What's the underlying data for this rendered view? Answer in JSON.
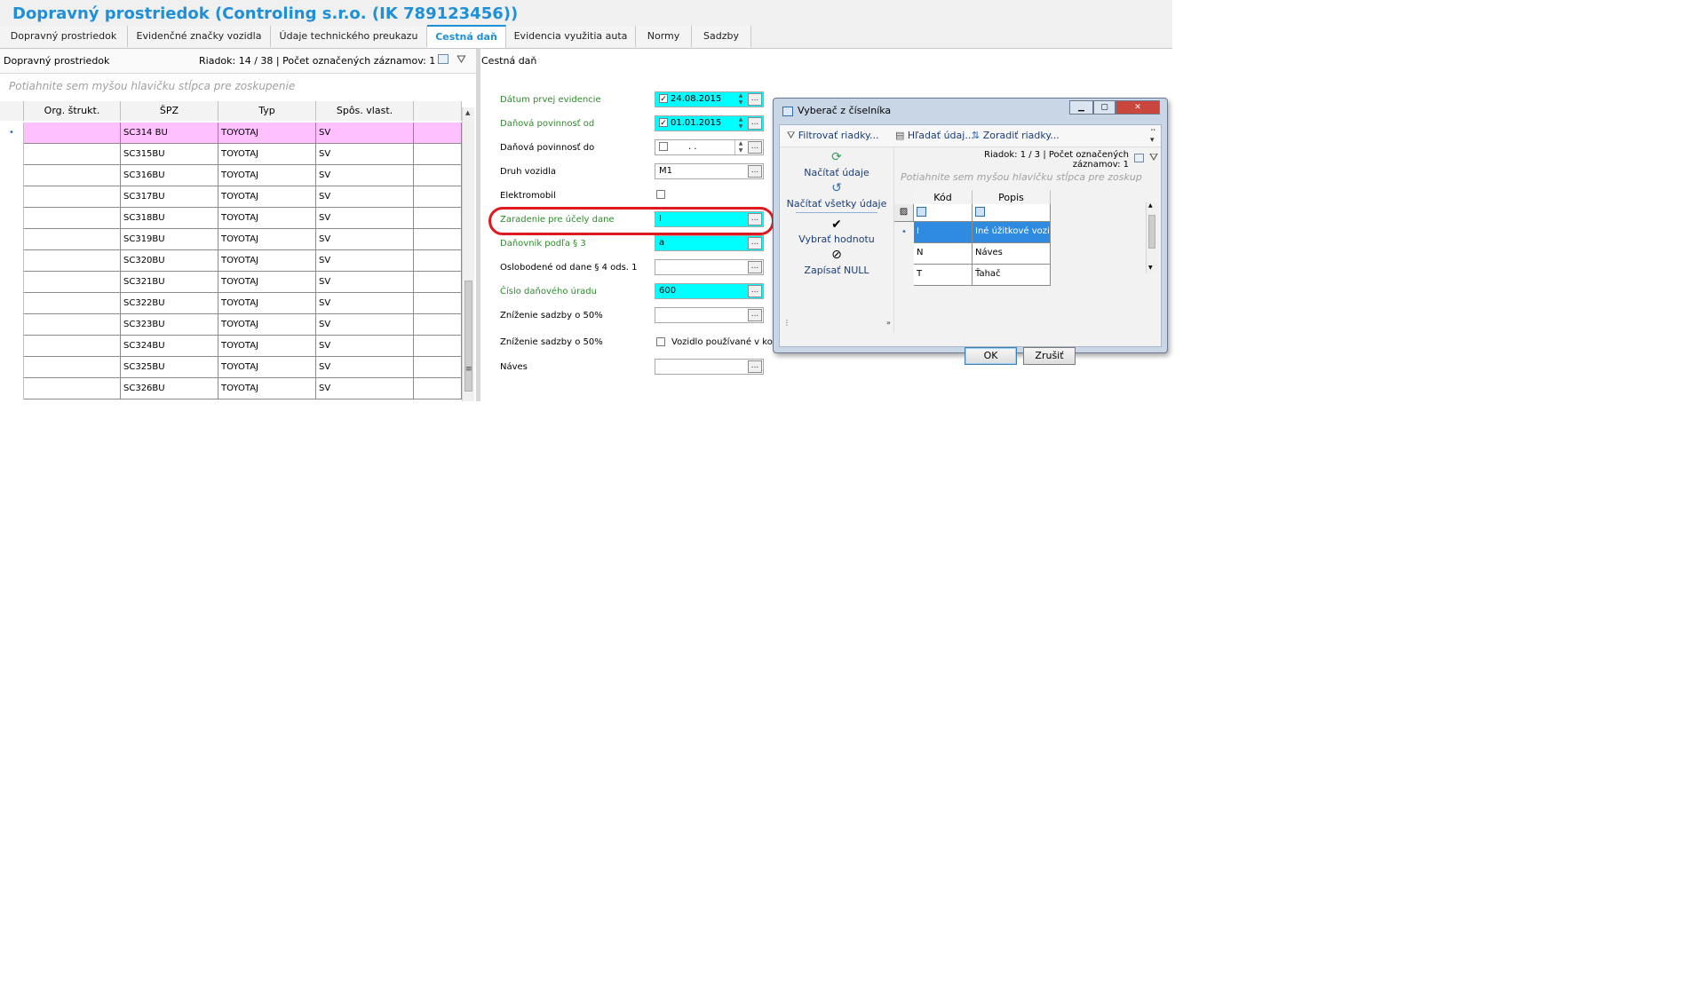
{
  "window": {
    "title": "Dopravný prostriedok (Controling s.r.o. (IK 789123456))"
  },
  "tabs": [
    {
      "label": "Dopravný prostriedok",
      "active": false
    },
    {
      "label": "Evidenčné značky vozidla",
      "active": false
    },
    {
      "label": "Údaje technického preukazu",
      "active": false
    },
    {
      "label": "Cestná daň",
      "active": true
    },
    {
      "label": "Evidencia využitia auta",
      "active": false
    },
    {
      "label": "Normy",
      "active": false
    },
    {
      "label": "Sadzby",
      "active": false
    }
  ],
  "left_panel": {
    "title": "Dopravný prostriedok",
    "status": "Riadok: 14 / 38 | Počet označených záznamov: 1",
    "group_hint": "Potiahnite sem myšou hlavičku stĺpca pre zoskupenie",
    "columns": [
      "Org. štrukt.",
      "ŠPZ",
      "Typ",
      "Spôs. vlast."
    ],
    "row_indicator": "•",
    "rows": [
      {
        "org": "",
        "spz": "SC314 BU",
        "typ": "TOYOTAJ",
        "vlast": "SV"
      },
      {
        "org": "",
        "spz": "SC315BU",
        "typ": "TOYOTAJ",
        "vlast": "SV"
      },
      {
        "org": "",
        "spz": "SC316BU",
        "typ": "TOYOTAJ",
        "vlast": "SV"
      },
      {
        "org": "",
        "spz": "SC317BU",
        "typ": "TOYOTAJ",
        "vlast": "SV"
      },
      {
        "org": "",
        "spz": "SC318BU",
        "typ": "TOYOTAJ",
        "vlast": "SV"
      },
      {
        "org": "",
        "spz": "SC319BU",
        "typ": "TOYOTAJ",
        "vlast": "SV"
      },
      {
        "org": "",
        "spz": "SC320BU",
        "typ": "TOYOTAJ",
        "vlast": "SV"
      },
      {
        "org": "",
        "spz": "SC321BU",
        "typ": "TOYOTAJ",
        "vlast": "SV"
      },
      {
        "org": "",
        "spz": "SC322BU",
        "typ": "TOYOTAJ",
        "vlast": "SV"
      },
      {
        "org": "",
        "spz": "SC323BU",
        "typ": "TOYOTAJ",
        "vlast": "SV"
      },
      {
        "org": "",
        "spz": "SC324BU",
        "typ": "TOYOTAJ",
        "vlast": "SV"
      },
      {
        "org": "",
        "spz": "SC325BU",
        "typ": "TOYOTAJ",
        "vlast": "SV"
      },
      {
        "org": "",
        "spz": "SC326BU",
        "typ": "TOYOTAJ",
        "vlast": "SV"
      }
    ]
  },
  "right_panel": {
    "title": "Cestná daň",
    "fields": {
      "datum_prvej_evidencie": {
        "label": "Dátum prvej evidencie",
        "value": "24.08.2015",
        "checked": true
      },
      "danova_povinnost_od": {
        "label": "Daňová povinnosť od",
        "value": "01.01.2015",
        "checked": true
      },
      "danova_povinnost_do": {
        "label": "Daňová povinnosť do",
        "value": ". .",
        "checked": false
      },
      "druh_vozidla": {
        "label": "Druh vozidla",
        "value": "M1"
      },
      "elektromobil": {
        "label": "Elektromobil",
        "checked": false
      },
      "zaradenie": {
        "label": "Zaradenie pre účely dane",
        "value": "I"
      },
      "danovnik": {
        "label": "Daňovník podľa § 3",
        "value": "a"
      },
      "oslobodene": {
        "label": "Oslobodené od dane § 4 ods. 1",
        "value": ""
      },
      "cislo_uradu": {
        "label": "Číslo daňového úradu",
        "value": "600"
      },
      "znizenie1": {
        "label": "Zníženie sadzby o 50%",
        "value": ""
      },
      "znizenie2": {
        "label": "Zníženie sadzby o 50%",
        "checkbox_label": "Vozidlo používané v ko",
        "checked": false
      },
      "naves": {
        "label": "Náves",
        "value": ""
      }
    },
    "ellipsis": "..."
  },
  "dialog": {
    "title": "Vyberač z číselníka",
    "toolbar": {
      "filter": "Filtrovať riadky...",
      "search": "Hľadať údaj...",
      "sort": "Zoradiť riadky..."
    },
    "side": {
      "load": "Načítať údaje",
      "load_all": "Načítať všetky údaje",
      "select": "Vybrať hodnotu",
      "null": "Zapísať NULL"
    },
    "status": "Riadok: 1 / 3 | Počet označených záznamov: 1",
    "group_hint": "Potiahnite sem myšou hlavičku stĺpca pre zoskup",
    "columns": [
      "Kód",
      "Popis"
    ],
    "rows": [
      {
        "kod": "I",
        "popis": "Iné úžitkové vozi...",
        "selected": true
      },
      {
        "kod": "N",
        "popis": "Náves",
        "selected": false
      },
      {
        "kod": "T",
        "popis": "Ťahač",
        "selected": false
      }
    ],
    "row_indicator": "•",
    "buttons": {
      "ok": "OK",
      "cancel": "Zrušiť"
    }
  },
  "colors": {
    "accent": "#1f8fd8",
    "selection_pink": "#ffc0ff",
    "cyan_field": "#00ffff",
    "green_label": "#2e8b2e",
    "highlight_red": "#e01820"
  }
}
